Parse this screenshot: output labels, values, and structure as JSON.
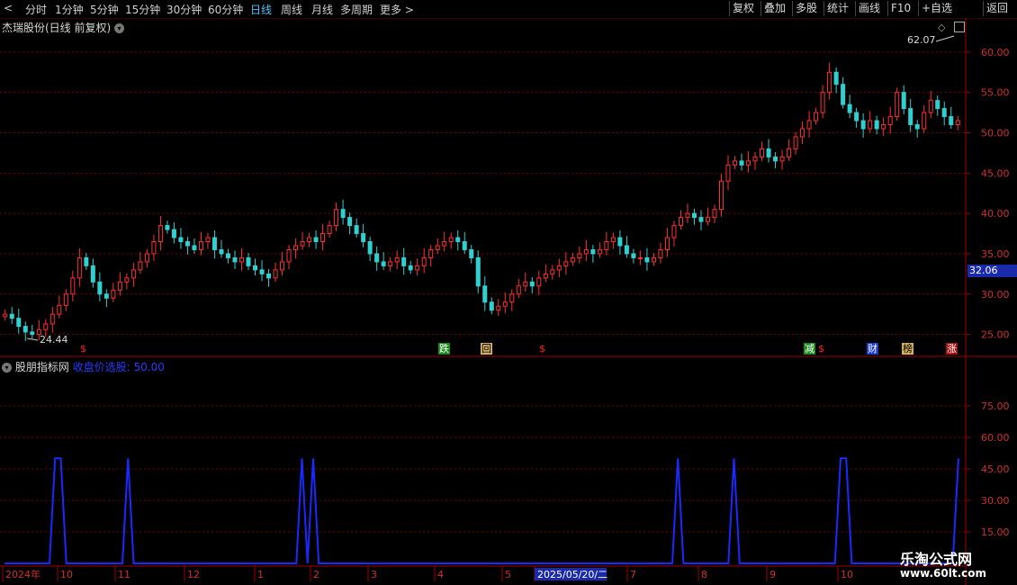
{
  "toolbar": {
    "periods": [
      "分时",
      "1分钟",
      "5分钟",
      "15分钟",
      "30分钟",
      "60分钟",
      "日线",
      "周线",
      "月线",
      "多周期"
    ],
    "active_period": "日线",
    "more": "更多",
    "right_buttons": [
      "复权",
      "叠加",
      "多股",
      "统计",
      "画线",
      "F10",
      "+自选",
      "返回"
    ]
  },
  "chart_title": "杰瑞股份(日线 前复权)",
  "price_axis": {
    "ticks": [
      "60.00",
      "55.00",
      "50.00",
      "45.00",
      "40.00",
      "35.00",
      "30.00",
      "25.00"
    ]
  },
  "current_price": "32.06",
  "high_label": "62.07",
  "low_label": "24.44",
  "markers": [
    {
      "text": "$",
      "color": "#ff2020",
      "bg": "none"
    },
    {
      "text": "跌",
      "color": "#ffffff",
      "bg": "#1a8a1a"
    },
    {
      "text": "回",
      "color": "#000000",
      "bg": "#d4b060"
    },
    {
      "text": "$",
      "color": "#ff2020",
      "bg": "none"
    },
    {
      "text": "减",
      "color": "#ffffff",
      "bg": "#1a8a1a"
    },
    {
      "text": "$",
      "color": "#ff2020",
      "bg": "none"
    },
    {
      "text": "财",
      "color": "#ffffff",
      "bg": "#1a3ad0"
    },
    {
      "text": "榜",
      "color": "#000000",
      "bg": "#d4b060"
    },
    {
      "text": "涨",
      "color": "#ffffff",
      "bg": "#a01010"
    }
  ],
  "indicator": {
    "name": "股朋指标网",
    "value_label": "收盘价选股: 50.00",
    "ticks": [
      "75.00",
      "60.00",
      "45.00",
      "30.00",
      "15.00"
    ]
  },
  "date_axis": {
    "labels": [
      "2024年",
      "10",
      "11",
      "12",
      "1",
      "2",
      "3",
      "4",
      "5",
      "2025/05/20/二",
      "7",
      "8",
      "9",
      "10"
    ]
  },
  "watermark": {
    "title": "乐淘公式网",
    "url": "www.60lt.com"
  },
  "colors": {
    "up": "#ff3030",
    "down": "#30d0d0",
    "grid": "#7a0000",
    "indicator": "#1a2aff"
  },
  "chart_data": {
    "type": "candlestick",
    "ylim": [
      22.5,
      64
    ],
    "y_ticks": [
      25,
      30,
      35,
      40,
      45,
      50,
      55,
      60
    ],
    "high": 62.07,
    "low": 24.44,
    "last": 32.06,
    "closes": [
      27.5,
      27.0,
      26.0,
      25.3,
      25.0,
      25.6,
      26.3,
      27.5,
      28.6,
      30.0,
      32.0,
      34.5,
      33.5,
      31.5,
      30.0,
      29.5,
      30.5,
      31.5,
      32.0,
      33.0,
      34.0,
      35.0,
      36.5,
      38.5,
      38.0,
      37.0,
      36.5,
      36.0,
      35.5,
      36.5,
      37.0,
      35.5,
      35.0,
      34.5,
      34.0,
      34.5,
      33.5,
      33.0,
      32.5,
      32.0,
      33.0,
      34.0,
      35.5,
      36.0,
      36.5,
      37.0,
      36.5,
      37.5,
      38.5,
      40.5,
      39.5,
      38.5,
      37.5,
      36.5,
      35.0,
      34.0,
      33.5,
      34.0,
      34.5,
      33.5,
      33.0,
      33.5,
      34.5,
      35.5,
      36.0,
      36.5,
      37.0,
      36.5,
      35.5,
      34.5,
      31.0,
      29.0,
      28.0,
      28.5,
      29.0,
      30.0,
      31.0,
      31.5,
      31.0,
      32.0,
      32.5,
      33.0,
      33.5,
      34.0,
      34.5,
      35.0,
      35.5,
      35.0,
      35.5,
      36.5,
      37.0,
      36.0,
      35.0,
      34.5,
      34.5,
      34.0,
      34.5,
      35.5,
      37.0,
      38.5,
      39.5,
      40.0,
      39.5,
      39.0,
      39.5,
      40.5,
      44.0,
      46.0,
      46.5,
      46.0,
      46.5,
      47.0,
      48.0,
      47.0,
      46.5,
      47.0,
      48.0,
      49.5,
      50.5,
      51.5,
      52.5,
      55.0,
      57.5,
      56.0,
      53.5,
      52.5,
      51.5,
      50.5,
      51.5,
      50.5,
      51.0,
      52.0,
      55.0,
      53.0,
      51.0,
      50.5,
      52.5,
      54.0,
      53.0,
      52.0,
      51.0,
      51.5
    ]
  },
  "indicator_data": {
    "type": "line",
    "ylim": [
      0,
      90
    ],
    "y_ticks": [
      15,
      30,
      45,
      60,
      75
    ],
    "pulses": [
      {
        "day": 9,
        "value": 50
      },
      {
        "day": 10,
        "value": 50
      },
      {
        "day": 22,
        "value": 50
      },
      {
        "day": 53,
        "value": 50
      },
      {
        "day": 55,
        "value": 50
      },
      {
        "day": 120,
        "value": 50
      },
      {
        "day": 130,
        "value": 50
      },
      {
        "day": 149,
        "value": 50
      },
      {
        "day": 150,
        "value": 50
      },
      {
        "day": 170,
        "value": 50
      }
    ],
    "total_days": 171
  }
}
